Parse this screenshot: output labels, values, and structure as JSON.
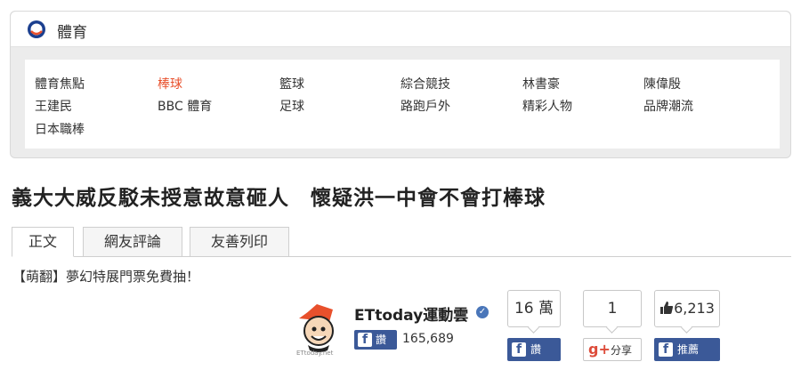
{
  "section": {
    "title": "體育",
    "links": [
      {
        "label": "體育焦點",
        "active": false
      },
      {
        "label": "棒球",
        "active": true
      },
      {
        "label": "籃球",
        "active": false
      },
      {
        "label": "綜合競技",
        "active": false
      },
      {
        "label": "林書豪",
        "active": false
      },
      {
        "label": "陳偉殷",
        "active": false
      },
      {
        "label": "王建民",
        "active": false
      },
      {
        "label": "BBC 體育",
        "active": false
      },
      {
        "label": "足球",
        "active": false
      },
      {
        "label": "路跑戶外",
        "active": false
      },
      {
        "label": "精彩人物",
        "active": false
      },
      {
        "label": "品牌潮流",
        "active": false
      },
      {
        "label": "日本職棒",
        "active": false
      }
    ]
  },
  "article": {
    "headline": "義大大威反駁未授意故意砸人　懷疑洪一中會不會打棒球",
    "tabs": [
      "正文",
      "網友評論",
      "友善列印"
    ],
    "promo": "【萌翻】夢幻特展門票免費抽！"
  },
  "social": {
    "brand_name": "ETtoday運動雲",
    "mascot_caption": "ETtoday.net",
    "follow_label": "讚",
    "fan_count": "165,689",
    "share_count": "16 萬",
    "share_label": "讚",
    "gplus_count": "1",
    "gplus_label": "分享",
    "like_count": "6,213",
    "recommend_label": "推薦"
  },
  "colors": {
    "accent": "#e8502c",
    "facebook": "#3b5998",
    "google_plus": "#dd4b39"
  }
}
